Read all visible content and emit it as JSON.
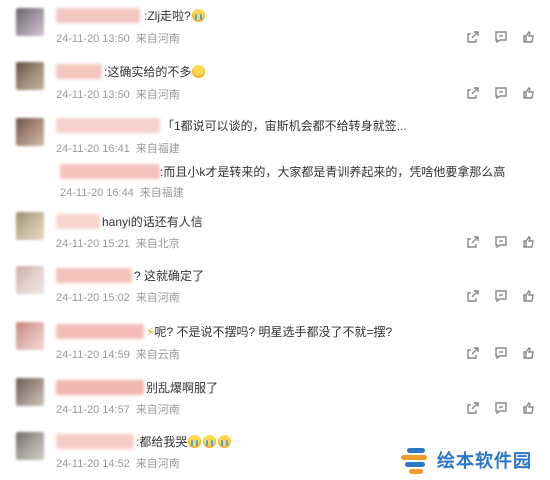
{
  "colors": {
    "meta": "#999999",
    "text": "#333333",
    "watermark": "#2d77c7"
  },
  "comments": [
    {
      "text_suffix": ":Zlj走啦?",
      "emoji": "cry",
      "date": "24-11-20 13:50",
      "location": "来自河南",
      "avatar_color": "#8a7d8a",
      "author_color": "#f3c7c2"
    },
    {
      "text_suffix": ":这确实给的不多",
      "emoji": "smile",
      "date": "24-11-20 13:50",
      "location": "来自河南",
      "avatar_color": "#8b7b6b",
      "author_color": "#f4c6bd"
    },
    {
      "text_suffix": "「1都说可以谈的，宙斯机会都不给转身就签...",
      "date": "24-11-20 16:41",
      "location": "来自福建",
      "avatar_color": "#8c7265",
      "author_color": "#f5d2cc",
      "reply": {
        "text_suffix": ":而且小k才是转来的，大家都是青训养起来的，凭啥他要拿那么高",
        "date": "24-11-20 16:44",
        "location": "来自福建",
        "author_color": "#f6c2bb"
      }
    },
    {
      "text_suffix": "hanyi的话还有人信",
      "date": "24-11-20 15:21",
      "location": "来自北京",
      "avatar_color": "#b6a88f",
      "author_color": "#f7d4cc"
    },
    {
      "text_suffix": "? 这就确定了",
      "date": "24-11-20 15:02",
      "location": "来自河南",
      "avatar_color": "#d9c2bc",
      "author_color": "#f4c2bb"
    },
    {
      "text_suffix": "呢? 不是说不摆吗? 明星选手都没了不就=摆?",
      "bolt": "⚡",
      "date": "24-11-20 14:59",
      "location": "来自云南",
      "avatar_color": "#d49c96",
      "author_color": "#f3bdb6"
    },
    {
      "text_suffix": "别乱爆啊服了",
      "date": "24-11-20 14:57",
      "location": "来自河南",
      "avatar_color": "#8c7a70",
      "author_color": "#f2b7ae"
    },
    {
      "text_suffix": ":都给我哭",
      "emoji_count": 3,
      "date": "24-11-20 14:52",
      "location": "来自河南",
      "avatar_color": "#8d8a82",
      "author_color": "#f5cdc6"
    }
  ],
  "watermark": {
    "text": "绘本软件园"
  },
  "icons": [
    "share-icon",
    "reply-icon",
    "like-icon"
  ]
}
